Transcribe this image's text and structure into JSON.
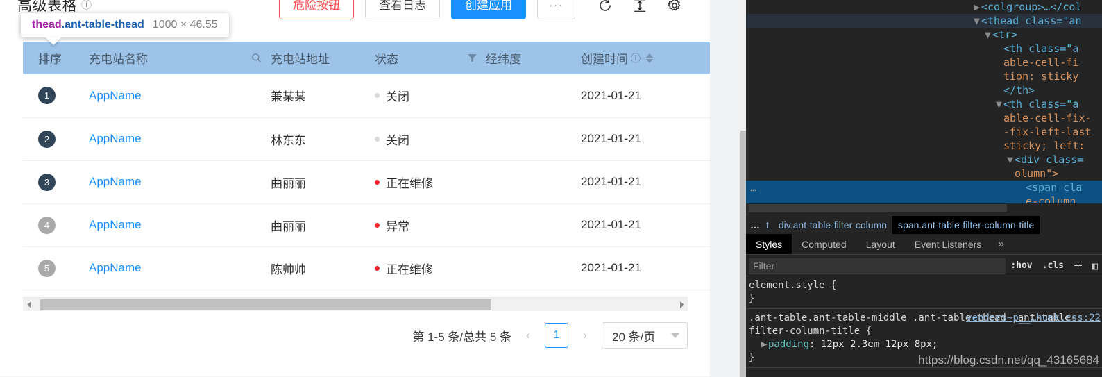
{
  "page": {
    "title": "高级表格",
    "title_help_icon": "question-circle-icon",
    "toolbar": {
      "danger_label": "危险按钮",
      "log_label": "查看日志",
      "create_label": "创建应用",
      "ellipsis_label": "···",
      "reload_icon": "reload-icon",
      "column_height_icon": "column-height-icon",
      "setting_icon": "gear-icon"
    },
    "table": {
      "columns": [
        {
          "key": "rank",
          "label": "排序",
          "icon": ""
        },
        {
          "key": "name",
          "label": "充电站名称",
          "icon": "search-icon"
        },
        {
          "key": "addr",
          "label": "充电站地址",
          "icon": ""
        },
        {
          "key": "status",
          "label": "状态",
          "icon": "filter-icon"
        },
        {
          "key": "geo",
          "label": "经纬度",
          "icon": ""
        },
        {
          "key": "time",
          "label": "创建时间",
          "icon": "question-circle-icon",
          "sorter": true
        }
      ],
      "rows": [
        {
          "rank": "1",
          "rank_style": "dark",
          "name": "AppName",
          "addr": "兼某某",
          "status": "关闭",
          "status_color": "#d9d9d9",
          "geo": "",
          "time": "2021-01-21"
        },
        {
          "rank": "2",
          "rank_style": "dark",
          "name": "AppName",
          "addr": "林东东",
          "status": "关闭",
          "status_color": "#d9d9d9",
          "geo": "",
          "time": "2021-01-21"
        },
        {
          "rank": "3",
          "rank_style": "dark",
          "name": "AppName",
          "addr": "曲丽丽",
          "status": "正在维修",
          "status_color": "#f5222d",
          "geo": "",
          "time": "2021-01-21"
        },
        {
          "rank": "4",
          "rank_style": "gray",
          "name": "AppName",
          "addr": "曲丽丽",
          "status": "异常",
          "status_color": "#f5222d",
          "geo": "",
          "time": "2021-01-21"
        },
        {
          "rank": "5",
          "rank_style": "gray",
          "name": "AppName",
          "addr": "陈帅帅",
          "status": "正在维修",
          "status_color": "#f5222d",
          "geo": "",
          "time": "2021-01-21"
        }
      ]
    },
    "pagination": {
      "total_text": "第 1-5 条/总共 5 条",
      "prev_icon": "chevron-left-icon",
      "current_page": "1",
      "next_icon": "chevron-right-icon",
      "page_size_label": "20 条/页",
      "page_size_caret": "chevron-down-icon"
    },
    "scrollbar": {
      "left_arrow_icon": "triangle-left-icon",
      "right_arrow_icon": "triangle-right-icon"
    }
  },
  "inspector_tooltip": {
    "tag": "thead",
    "classes": ".ant-table-thead",
    "dimensions": "1000 × 46.55"
  },
  "devtools": {
    "dom_rows": [
      {
        "indent": 0,
        "arrow": "▶",
        "segments": [
          {
            "t": "<colgroup>…</col",
            "c": "tg"
          }
        ],
        "highlight": "none"
      },
      {
        "indent": 0,
        "arrow": "▼",
        "segments": [
          {
            "t": "<thead class=\"an",
            "c": "tg"
          }
        ],
        "highlight": "grey"
      },
      {
        "indent": 1,
        "arrow": "▼",
        "segments": [
          {
            "t": "<tr>",
            "c": "tg"
          }
        ],
        "highlight": "none"
      },
      {
        "indent": 2,
        "arrow": "",
        "segments": [
          {
            "t": "<th class=\"a",
            "c": "tg"
          }
        ],
        "highlight": "none"
      },
      {
        "indent": 2,
        "arrow": "",
        "segments": [
          {
            "t": "able-cell-fi",
            "c": "ta"
          }
        ],
        "highlight": "none"
      },
      {
        "indent": 2,
        "arrow": "",
        "segments": [
          {
            "t": "tion: sticky",
            "c": "ta"
          }
        ],
        "highlight": "none"
      },
      {
        "indent": 2,
        "arrow": "",
        "segments": [
          {
            "t": "</th>",
            "c": "tg"
          }
        ],
        "highlight": "none"
      },
      {
        "indent": 2,
        "arrow": "▼",
        "segments": [
          {
            "t": "<th class=\"a",
            "c": "tg"
          }
        ],
        "highlight": "none"
      },
      {
        "indent": 2,
        "arrow": "",
        "segments": [
          {
            "t": "able-cell-fix-",
            "c": "ta"
          }
        ],
        "highlight": "none"
      },
      {
        "indent": 2,
        "arrow": "",
        "segments": [
          {
            "t": "-fix-left-last",
            "c": "ta"
          }
        ],
        "highlight": "none"
      },
      {
        "indent": 2,
        "arrow": "",
        "segments": [
          {
            "t": "sticky; left:",
            "c": "ta"
          }
        ],
        "highlight": "none"
      },
      {
        "indent": 3,
        "arrow": "▼",
        "segments": [
          {
            "t": "<div class=",
            "c": "tg"
          }
        ],
        "highlight": "none"
      },
      {
        "indent": 3,
        "arrow": "",
        "segments": [
          {
            "t": "olumn\">",
            "c": "ta"
          }
        ],
        "highlight": "none"
      },
      {
        "indent": 4,
        "arrow": "",
        "segments": [
          {
            "t": "<span cla",
            "c": "tg"
          }
        ],
        "highlight": "blue"
      },
      {
        "indent": 4,
        "arrow": "",
        "segments": [
          {
            "t": "e-column",
            "c": "ta"
          }
        ],
        "highlight": "blue"
      }
    ],
    "dom_selected_marker": "…",
    "breadcrumbs": [
      {
        "label": "…",
        "type": "dots"
      },
      {
        "label": "t",
        "type": "trunc"
      },
      {
        "label": "div.ant-table-filter-column",
        "type": "normal"
      },
      {
        "label": "span.ant-table-filter-column-title",
        "type": "active"
      }
    ],
    "tabs": [
      {
        "label": "Styles",
        "active": true
      },
      {
        "label": "Computed",
        "active": false
      },
      {
        "label": "Layout",
        "active": false
      },
      {
        "label": "Event Listeners",
        "active": false
      },
      {
        "label": "»",
        "active": false,
        "more": true
      }
    ],
    "filter": {
      "placeholder": "Filter",
      "value": "",
      "hov_label": ":hov",
      "cls_label": ".cls",
      "add_icon": "plus-icon",
      "sidebar_icon": "toggle-sidebar-icon"
    },
    "style_rules": [
      {
        "selector": "element.style {",
        "close": "}",
        "source": "",
        "declarations": []
      },
      {
        "selector": ".ant-table.ant-table-middle .ant-table-thead .ant-table-filter-column-title {",
        "close": "}",
        "source": "vendors~p__…hunk.css:22",
        "declarations": [
          {
            "expander": "▶",
            "property": "padding",
            "value": "12px 2.3em 12px 8px;"
          }
        ]
      }
    ],
    "watermark": "https://blog.csdn.net/qq_43165684"
  }
}
